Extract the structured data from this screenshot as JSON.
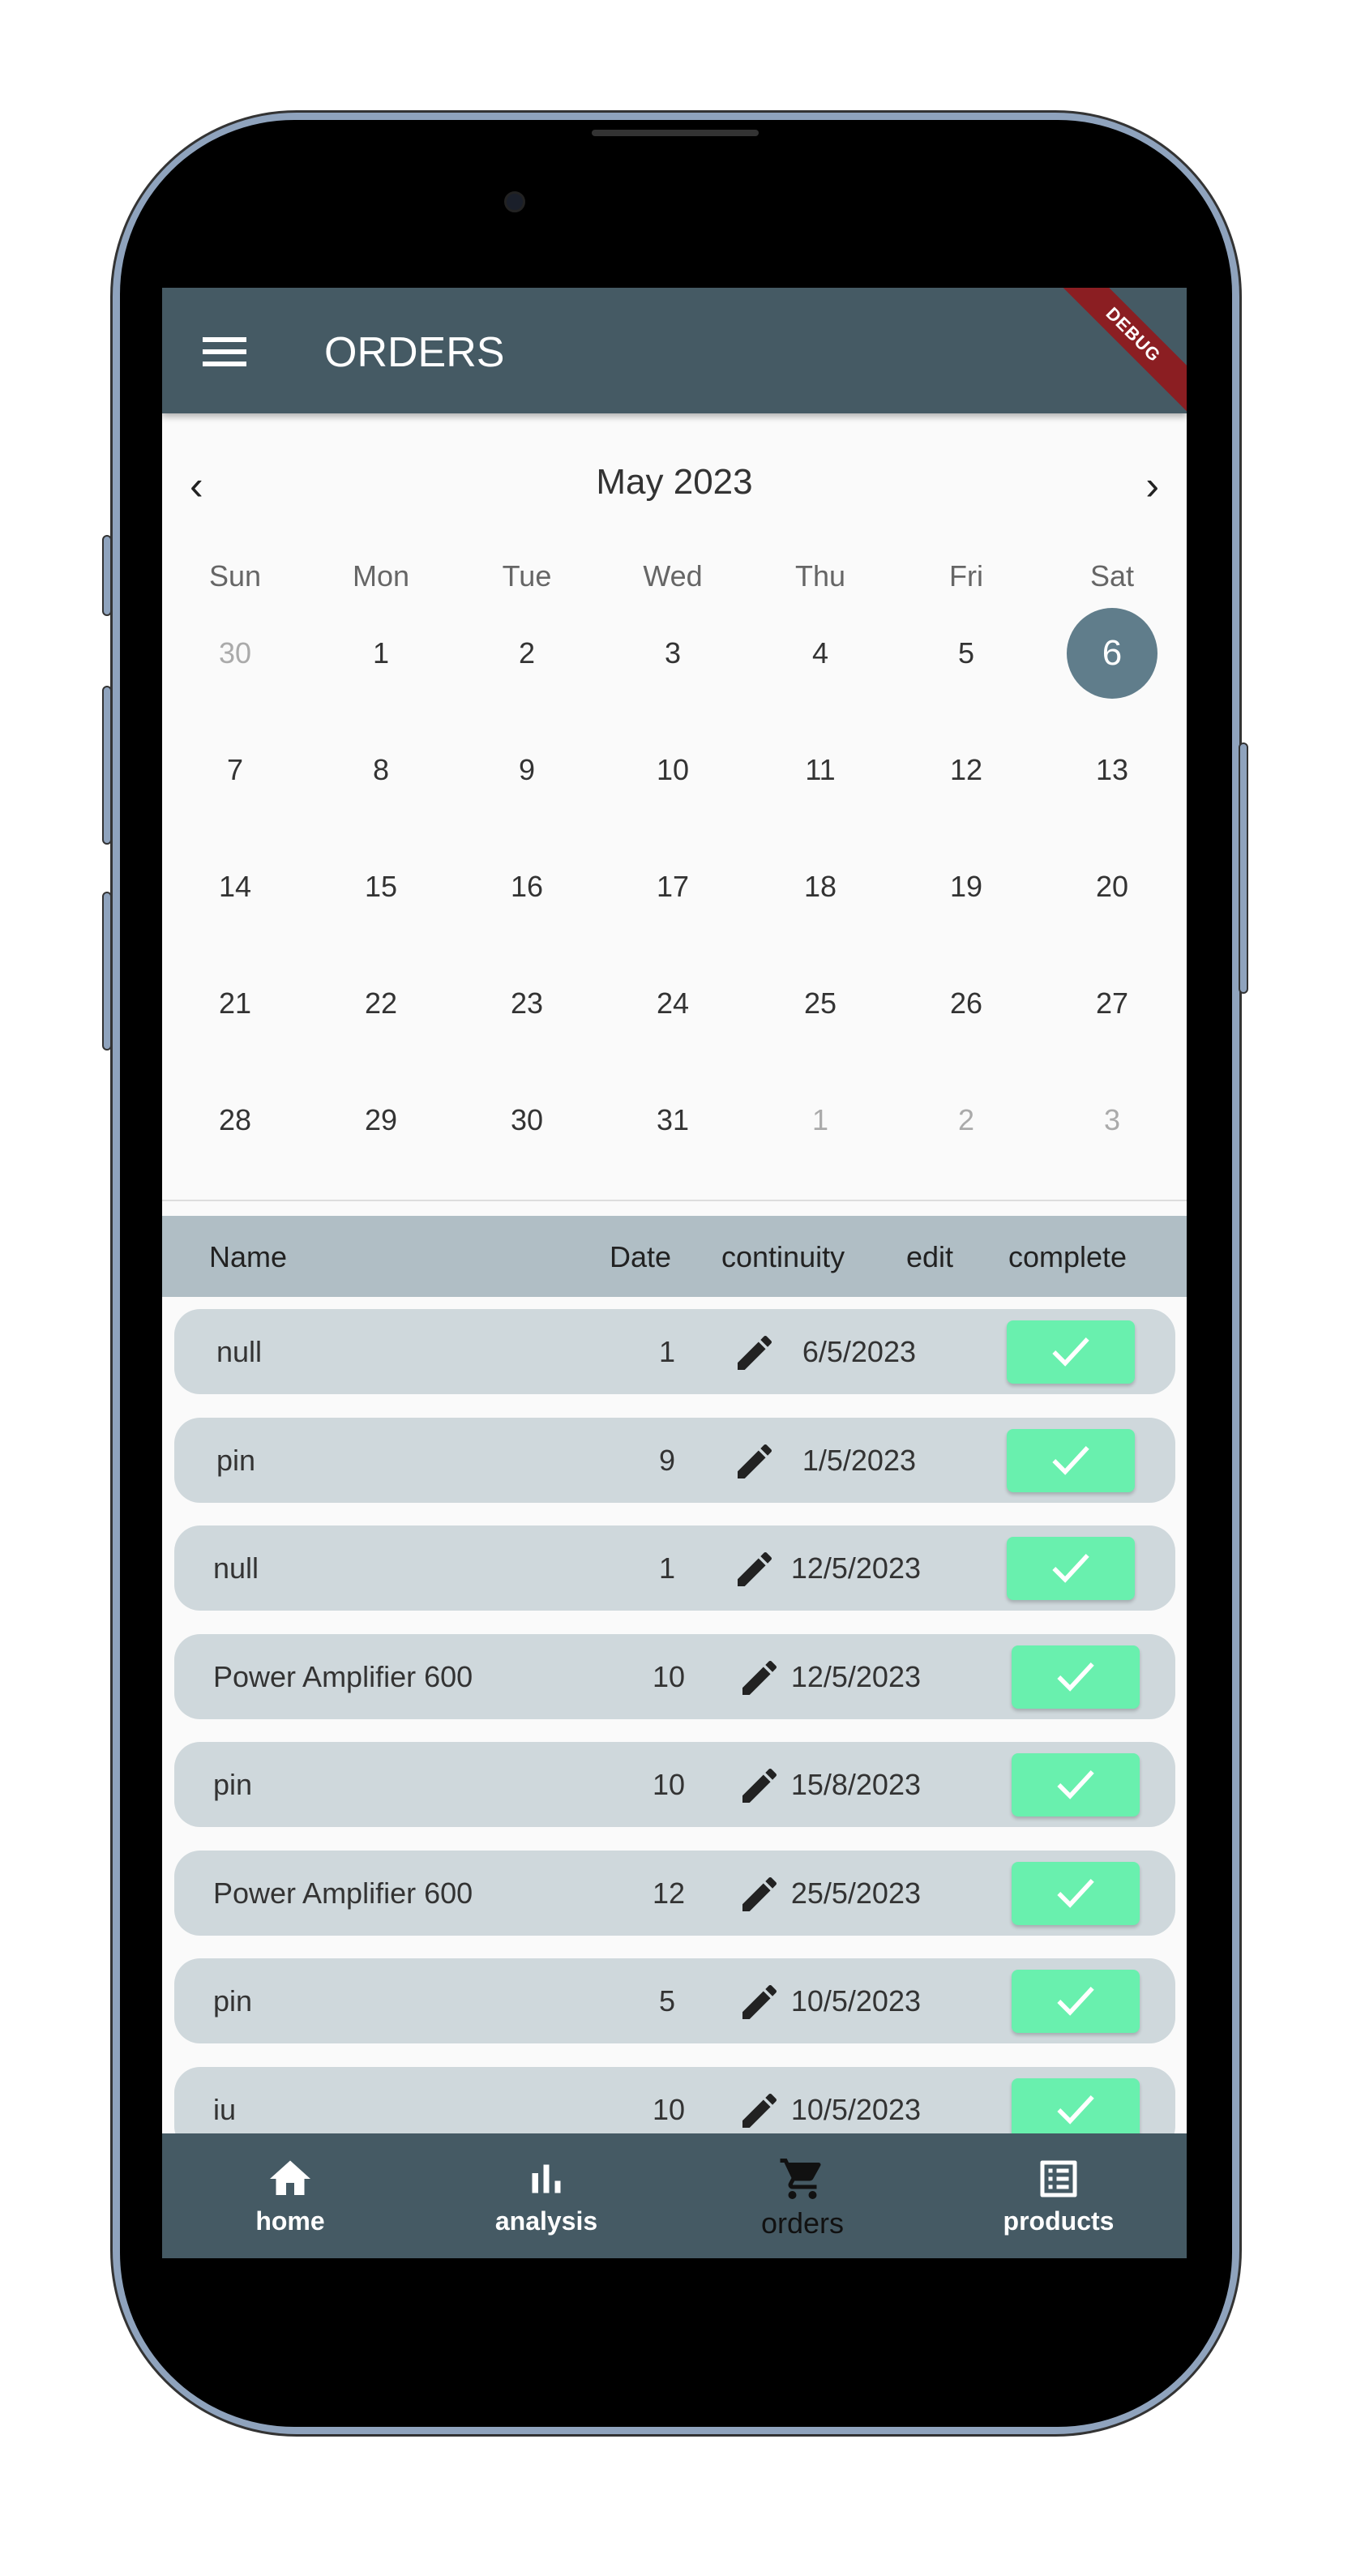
{
  "appbar": {
    "title": "ORDERS",
    "debug_banner": "DEBUG",
    "menu_icon": "hamburger-menu-icon"
  },
  "calendar": {
    "month_label": "May 2023",
    "weekdays": [
      "Sun",
      "Mon",
      "Tue",
      "Wed",
      "Thu",
      "Fri",
      "Sat"
    ],
    "days": [
      [
        "30",
        "1",
        "2",
        "3",
        "4",
        "5",
        "6"
      ],
      [
        "7",
        "8",
        "9",
        "10",
        "11",
        "12",
        "13"
      ],
      [
        "14",
        "15",
        "16",
        "17",
        "18",
        "19",
        "20"
      ],
      [
        "21",
        "22",
        "23",
        "24",
        "25",
        "26",
        "27"
      ],
      [
        "28",
        "29",
        "30",
        "31",
        "1",
        "2",
        "3"
      ]
    ],
    "selected": "6",
    "selected_color": "#607d8b"
  },
  "table": {
    "headers": {
      "name": "Name",
      "date": "Date",
      "continuity": "continuity",
      "edit": "edit",
      "complete": "complete"
    },
    "rows": [
      {
        "name": "null",
        "date": "6/5/2023",
        "continuity": "1"
      },
      {
        "name": "pin",
        "date": "1/5/2023",
        "continuity": "9"
      },
      {
        "name": "null",
        "date": "12/5/2023",
        "continuity": "1"
      },
      {
        "name": "Power Amplifier 600",
        "date": "12/5/2023",
        "continuity": "10"
      },
      {
        "name": "pin",
        "date": "15/8/2023",
        "continuity": "10"
      },
      {
        "name": "Power Amplifier 600",
        "date": "25/5/2023",
        "continuity": "12"
      },
      {
        "name": "pin",
        "date": "10/5/2023",
        "continuity": "5"
      },
      {
        "name": "iu",
        "date": "10/5/2023",
        "continuity": "10"
      }
    ],
    "complete_color": "#69f0ae"
  },
  "bottom_nav": {
    "items": [
      {
        "label": "home",
        "icon": "home-icon"
      },
      {
        "label": "analysis",
        "icon": "bar-chart-icon"
      },
      {
        "label": "orders",
        "icon": "cart-icon"
      },
      {
        "label": "products",
        "icon": "list-icon"
      }
    ],
    "active": "orders"
  },
  "colors": {
    "primary": "#455a64",
    "header": "#b0bec5",
    "row": "#cfd8dc"
  }
}
